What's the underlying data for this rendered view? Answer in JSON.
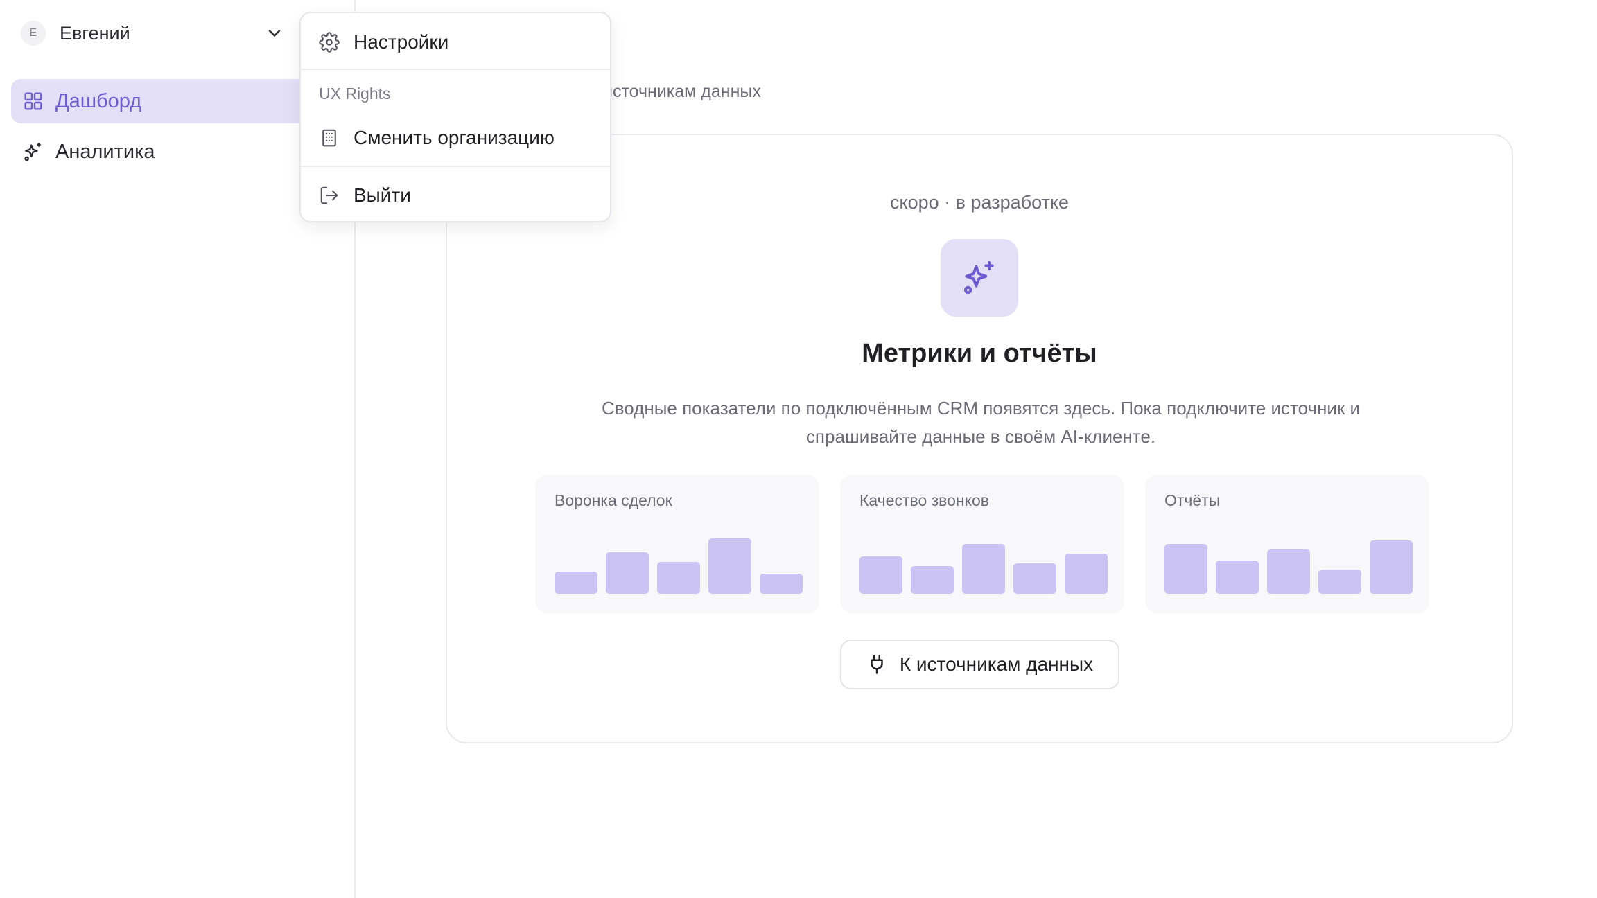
{
  "user": {
    "initial": "Е",
    "name": "Евгений"
  },
  "sidebar": {
    "items": [
      {
        "label": "Дашборд",
        "icon": "grid-icon",
        "active": true
      },
      {
        "label": "Аналитика",
        "icon": "sparkles-icon",
        "active": false
      }
    ]
  },
  "main": {
    "subtitle": "источникам данных"
  },
  "card": {
    "badge": "скоро · в разработке",
    "title": "Метрики и отчёты",
    "description": "Сводные показатели по подключённым CRM появятся здесь. Пока подключите источник и спрашивайте данные в своём AI-клиенте.",
    "mini_cards": [
      {
        "title": "Воронка сделок",
        "bar_levels": [
          0.4,
          0.75,
          0.58,
          1.0,
          0.36
        ]
      },
      {
        "title": "Качество звонков",
        "bar_levels": [
          0.68,
          0.5,
          0.9,
          0.55,
          0.72
        ]
      },
      {
        "title": "Отчёты",
        "bar_levels": [
          0.9,
          0.6,
          0.8,
          0.44,
          0.96
        ]
      }
    ],
    "button_label": "К источникам данных"
  },
  "menu": {
    "settings_label": "Настройки",
    "org_section": "UX Rights",
    "switch_org_label": "Сменить организацию",
    "logout_label": "Выйти"
  },
  "colors": {
    "accent": "#6d5ccf",
    "accent_soft": "#e3dff7",
    "bar": "#cbc3f3"
  }
}
